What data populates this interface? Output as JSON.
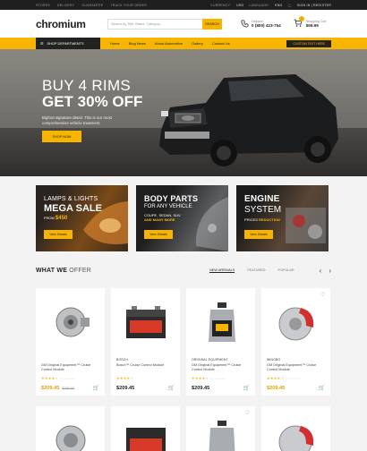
{
  "topbar": {
    "links": [
      "STORES",
      "DELIVERY",
      "GUARANTEE",
      "TRACK YOUR ORDER"
    ],
    "currency_label": "CURRENCY:",
    "currency": "USD",
    "language_label": "LANGUAGE:",
    "language": "ENG",
    "sign_in": "SIGN IN | REGISTER"
  },
  "header": {
    "logo": "chromium",
    "search_placeholder": "Search by Title, Brand, Category...",
    "search_button": "SEARCH",
    "helpline_label": "Helpline",
    "helpline_number": "0 (800) 423-754",
    "cart_label": "Shopping Cart",
    "cart_total": "$59.99",
    "cart_count": "0"
  },
  "nav": {
    "departments": "SHOP DEPARTMENTS",
    "items": [
      "Home",
      "Blog News",
      "About Automotive",
      "Gallery",
      "Contact Us"
    ],
    "custom": "CUSTOM TEXT HERE"
  },
  "hero": {
    "line1": "BUY 4 RIMS",
    "line2": "GET 30% OFF",
    "desc": "Bigfoot signature detail. This is our most comprehensive vehicle treatment.",
    "button": "SHOP NOW"
  },
  "banners": [
    {
      "t1": "LAMPS & LIGHTS",
      "t2": "MEGA SALE",
      "t3a": "FROM",
      "t3b": "$450",
      "button": "View Details"
    },
    {
      "t1": "BODY PARTS",
      "t2": "FOR ANY VEHICLE",
      "t3a": "COUPE, SEDAN, SUV",
      "t3b": "AND MANY MORE",
      "button": "View Details"
    },
    {
      "t1": "ENGINE",
      "t2": "SYSTEM",
      "t3a": "PRICES",
      "t3b": "REDUCTION",
      "button": "View Details"
    }
  ],
  "offer": {
    "title_bold": "WHAT WE",
    "title_light": "OFFER",
    "tabs": [
      "NEW ARRIVALS",
      "FEATURED",
      "POPULAR"
    ]
  },
  "products": [
    {
      "brand": "",
      "name": "GM Original Equipment™ Cruise Control Module",
      "stars": 4,
      "reviews": "(0 reviews)",
      "price": "$209.45",
      "old": "$280.00",
      "sale": true
    },
    {
      "brand": "BOSCH",
      "name": "Bosch™ Cruise Control Module",
      "stars": 4,
      "reviews": "",
      "price": "$209.45",
      "old": "",
      "sale": false
    },
    {
      "brand": "ORIGINAL EQUIPMENT",
      "name": "GM Original Equipment™ Cruise Control Module",
      "stars": 4,
      "reviews": "(0 reviews)",
      "price": "$209.45",
      "old": "",
      "sale": false
    },
    {
      "brand": "WINGBO",
      "name": "GM Original Equipment™ Cruise Control Module",
      "stars": 4,
      "reviews": "(0 reviews)",
      "price": "$209.45",
      "old": "",
      "sale": true
    }
  ],
  "colors": {
    "accent": "#f7b500",
    "dark": "#222222"
  }
}
